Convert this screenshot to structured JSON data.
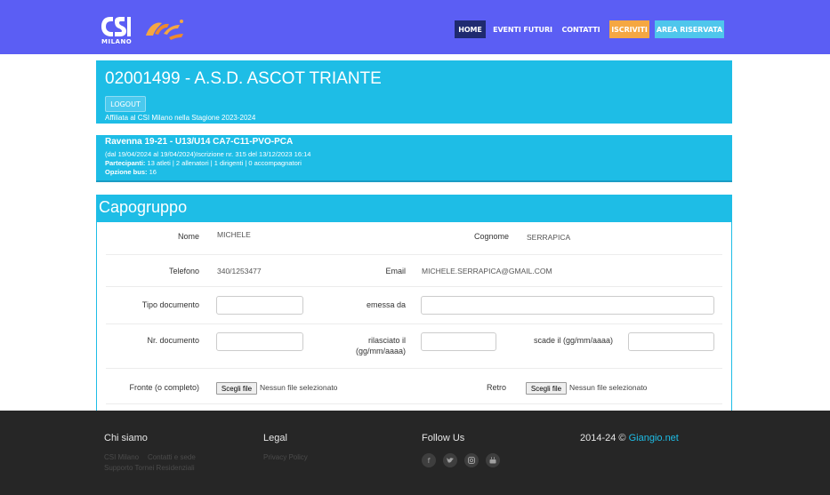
{
  "header": {
    "logo_text": "MILANO",
    "logo_script": "Stadium",
    "nav": [
      {
        "label": "HOME"
      },
      {
        "label": "EVENTI FUTURI"
      },
      {
        "label": "CONTATTI"
      },
      {
        "label": "ISCRIVITI"
      },
      {
        "label": "AREA RISERVATA"
      }
    ]
  },
  "club": {
    "title": "02001499 - A.S.D. ASCOT TRIANTE",
    "logout_label": "LOGOUT",
    "subtitle": "Affiliata al CSI Milano nella Stagione 2023-2024"
  },
  "event": {
    "title": "Ravenna 19-21 - U13/U14 CA7-C11-PVO-PCA",
    "dates": "(dal 19/04/2024 al 19/04/2024)Iscrizione nr. 315 del 13/12/2023 16:14",
    "participants_label": "Partecipanti:",
    "participants_value": "13 atleti | 2 allenatori | 1 dirigenti | 0 accompagnatori",
    "bus_label": "Opzione bus:",
    "bus_value": "16"
  },
  "capogruppo": {
    "title": "Capogruppo",
    "nome_label": "Nome",
    "nome_value": "MICHELE",
    "cognome_label": "Cognome",
    "cognome_value": "SERRAPICA",
    "telefono_label": "Telefono",
    "telefono_value": "340/1253477",
    "email_label": "Email",
    "email_value": "MICHELE.SERRAPICA@GMAIL.COM",
    "tipo_doc_label": "Tipo documento",
    "tipo_doc_value": "",
    "emessa_label": "emessa da",
    "emessa_value": "",
    "nr_doc_label": "Nr. documento",
    "nr_doc_value": "",
    "rilasciato_label_1": "rilasciato il",
    "rilasciato_label_2": "(gg/mm/aaaa)",
    "rilasciato_value": "",
    "scade_label": "scade il (gg/mm/aaaa)",
    "scade_value": "",
    "fronte_label": "Fronte (o completo)",
    "retro_label": "Retro",
    "file_button": "Scegli file",
    "file_status": "Nessun file selezionato"
  },
  "footer": {
    "chi_siamo": "Chi siamo",
    "chi_links": [
      "CSI Milano",
      "Contatti e sede",
      "Supporto Tornei Residenziali"
    ],
    "legal": "Legal",
    "privacy": "Privacy Policy",
    "follow": "Follow Us",
    "social_icons": [
      "facebook-icon",
      "twitter-icon",
      "instagram-icon",
      "youtube-icon"
    ],
    "copyright_prefix": "2014-24 ©",
    "copyright_brand": "Giangio.net"
  },
  "colors": {
    "navbar": "#5b5ef4",
    "panel": "#1ebde6",
    "home_active": "#1f2a70",
    "iscriviti": "#f5a742",
    "area_riservata": "#4fc6ec",
    "footer": "#262626"
  }
}
